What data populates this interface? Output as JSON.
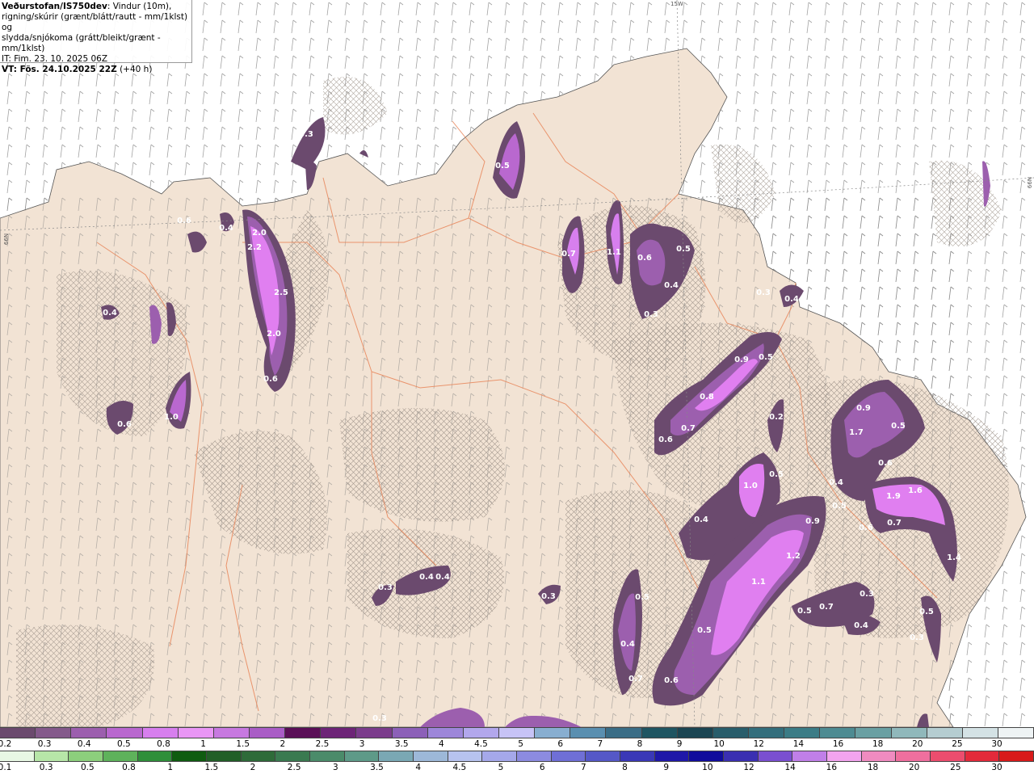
{
  "header": {
    "brand": "Veðurstofan/IS750dev",
    "desc_line1": ": Vindur (10m),",
    "desc_line2": "rigning/skúrir (grænt/blátt/rautt - mm/1klst) og",
    "desc_line3": "slydda/snjókoma (grátt/bleikt/grænt - mm/1klst)",
    "it": "IT: Fim. 23. 10. 2025 06Z",
    "vt": "VT: Fös. 24.10.2025 22Z",
    "lead": " (+40 h)"
  },
  "grid_labels": {
    "top": "15W",
    "left": "66N",
    "right": "66N"
  },
  "colors": {
    "sea": "#ffffff",
    "land": "#f2e3d4",
    "road": "#e8865a",
    "hatch": "#9a8f86",
    "precip_dark": "#6b4a6e",
    "precip_mid": "#9b4fb0",
    "precip_light": "#e07ff0"
  },
  "map_values": [
    {
      "v": "0.3"
    },
    {
      "v": "0.5"
    },
    {
      "v": "0.6"
    },
    {
      "v": "0.4"
    },
    {
      "v": "2.0"
    },
    {
      "v": "2.2"
    },
    {
      "v": "2.5"
    },
    {
      "v": "2.0"
    },
    {
      "v": "0.6"
    },
    {
      "v": "0.4"
    },
    {
      "v": "0.6"
    },
    {
      "v": "1.0"
    },
    {
      "v": "0.7"
    },
    {
      "v": "1.1"
    },
    {
      "v": "0.6"
    },
    {
      "v": "0.5"
    },
    {
      "v": "0.4"
    },
    {
      "v": "0.3"
    },
    {
      "v": "0.3"
    },
    {
      "v": "0.4"
    },
    {
      "v": "0.9"
    },
    {
      "v": "0.5"
    },
    {
      "v": "0.8"
    },
    {
      "v": "0.7"
    },
    {
      "v": "0.6"
    },
    {
      "v": "0.2"
    },
    {
      "v": "1.0"
    },
    {
      "v": "0.5"
    },
    {
      "v": "0.4"
    },
    {
      "v": "0.9"
    },
    {
      "v": "1.2"
    },
    {
      "v": "1.1"
    },
    {
      "v": "0.5"
    },
    {
      "v": "0.4"
    },
    {
      "v": "0.7"
    },
    {
      "v": "0.6"
    },
    {
      "v": "0.9"
    },
    {
      "v": "0.5"
    },
    {
      "v": "1.7"
    },
    {
      "v": "0.6"
    },
    {
      "v": "0.4"
    },
    {
      "v": "1.9"
    },
    {
      "v": "1.6"
    },
    {
      "v": "0.5"
    },
    {
      "v": "0.6"
    },
    {
      "v": "0.7"
    },
    {
      "v": "1.4"
    },
    {
      "v": "0.3"
    },
    {
      "v": "0.5"
    },
    {
      "v": "0.7"
    },
    {
      "v": "0.4"
    },
    {
      "v": "0.5"
    },
    {
      "v": "0.3"
    },
    {
      "v": "0.4"
    },
    {
      "v": "0.4"
    },
    {
      "v": "0.3"
    },
    {
      "v": "0.3"
    },
    {
      "v": "0.5"
    },
    {
      "v": "0.3"
    }
  ],
  "legend_top": {
    "colors": [
      "#6b4a6e",
      "#845a8b",
      "#9c5fae",
      "#b968cf",
      "#d77fee",
      "#e996f5",
      "#c779e0",
      "#a95dc6",
      "#5a0f57",
      "#6d2477",
      "#7b3c8c",
      "#8c60b8",
      "#9d86d9",
      "#b2a7ec",
      "#c7c3f6",
      "#88aed0",
      "#5a8fb0",
      "#3a6d86",
      "#1f5562",
      "#1b4552",
      "#285d6b",
      "#336e7c",
      "#3b7c86",
      "#4e8b92",
      "#6aa0a3",
      "#90b8bb",
      "#b5cdd1",
      "#d4e2e5",
      "#eef3f4"
    ],
    "labels": [
      "0.2",
      "0.3",
      "0.4",
      "0.5",
      "0.8",
      "1",
      "1.5",
      "2",
      "2.5",
      "3",
      "3.5",
      "4",
      "4.5",
      "5",
      "6",
      "7",
      "8",
      "9",
      "10",
      "12",
      "14",
      "16",
      "18",
      "20",
      "25",
      "30"
    ]
  },
  "legend_bottom": {
    "colors": [
      "#e8f8e4",
      "#b7e6a8",
      "#8ccf7c",
      "#5eb25b",
      "#2f8f3a",
      "#0f5c10",
      "#215f27",
      "#2e6b39",
      "#3a7a50",
      "#4b8b6a",
      "#5e9a88",
      "#7aa8b4",
      "#9db8d8",
      "#b7c3ee",
      "#a5a8ea",
      "#8c8be0",
      "#6f6fd6",
      "#5558c7",
      "#3a38b7",
      "#1f18a8",
      "#100c9c",
      "#3a2fb1",
      "#7a4fd0",
      "#c07fe8",
      "#f2a4ee",
      "#f08bc0",
      "#ef6f9e",
      "#ec4d6e",
      "#e32a3a",
      "#d81a1a"
    ],
    "labels": [
      "0.1",
      "0.3",
      "0.5",
      "0.8",
      "1",
      "1.5",
      "2",
      "2.5",
      "3",
      "3.5",
      "4",
      "4.5",
      "5",
      "6",
      "7",
      "8",
      "9",
      "10",
      "12",
      "14",
      "16",
      "18",
      "20",
      "25",
      "30"
    ]
  }
}
